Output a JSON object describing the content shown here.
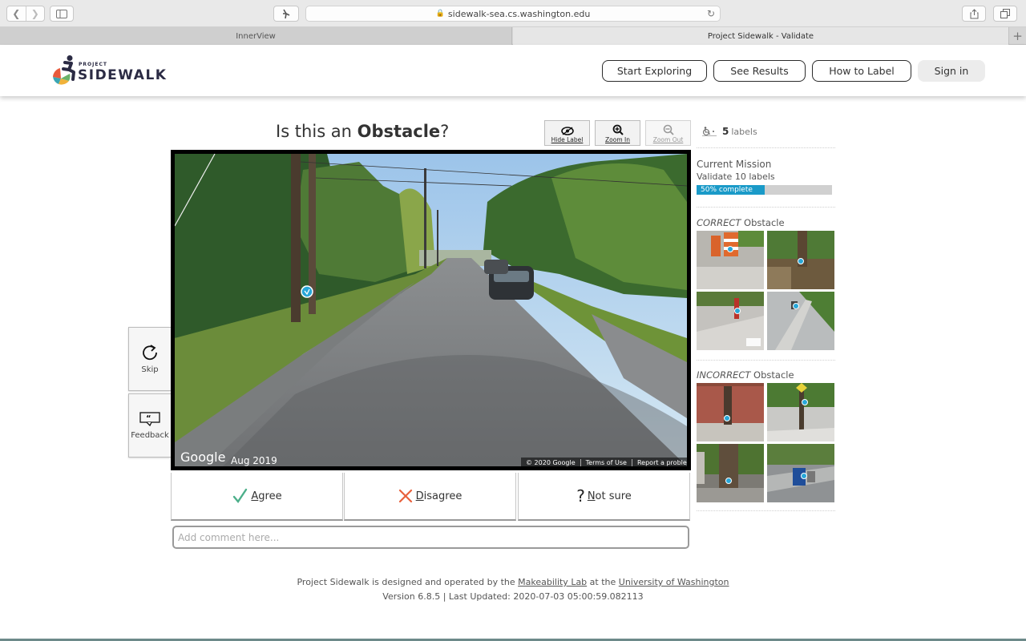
{
  "browser": {
    "url": "sidewalk-sea.cs.washington.edu",
    "tabs": [
      {
        "label": "InnerView"
      },
      {
        "label": "Project Sidewalk - Validate"
      }
    ]
  },
  "header": {
    "logo_small": "PROJECT",
    "logo_big": "SIDEWALK",
    "nav": {
      "start_exploring": "Start Exploring",
      "see_results": "See Results",
      "how_to_label": "How to Label",
      "sign_in": "Sign in"
    }
  },
  "question": {
    "prefix": "Is this an ",
    "label_type": "Obstacle",
    "suffix": "?"
  },
  "tools": {
    "hide_label": "Hide Label",
    "zoom_in": "Zoom In",
    "zoom_out": "Zoom Out"
  },
  "label_count": {
    "count": "5",
    "unit": "labels"
  },
  "pano": {
    "brand": "Google",
    "date": "Aug 2019",
    "copyright": "© 2020 Google",
    "terms": "Terms of Use",
    "report": "Report a problem"
  },
  "side": {
    "skip": "Skip",
    "feedback": "Feedback"
  },
  "actions": {
    "agree_key": "A",
    "agree_rest": "gree",
    "disagree_key": "D",
    "disagree_rest": "isagree",
    "notsure_key": "N",
    "notsure_rest": "ot sure",
    "comment_placeholder": "Add comment here..."
  },
  "mission": {
    "title": "Current Mission",
    "subtitle": "Validate 10 labels",
    "progress_text": "50% complete",
    "progress_fraction": 0.5
  },
  "examples": {
    "correct_prefix": "CORRECT",
    "incorrect_prefix": "INCORRECT",
    "label": "Obstacle"
  },
  "footer": {
    "line1_a": "Project Sidewalk is designed and operated by the ",
    "makeability": "Makeability Lab",
    "line1_b": " at the ",
    "uw": "University of Washington",
    "line2": "Version 6.8.5 | Last Updated: 2020-07-03 05:00:59.082113"
  },
  "colors": {
    "accent": "#1a9ac8",
    "agree": "#4caf8a",
    "disagree": "#e8603c"
  }
}
